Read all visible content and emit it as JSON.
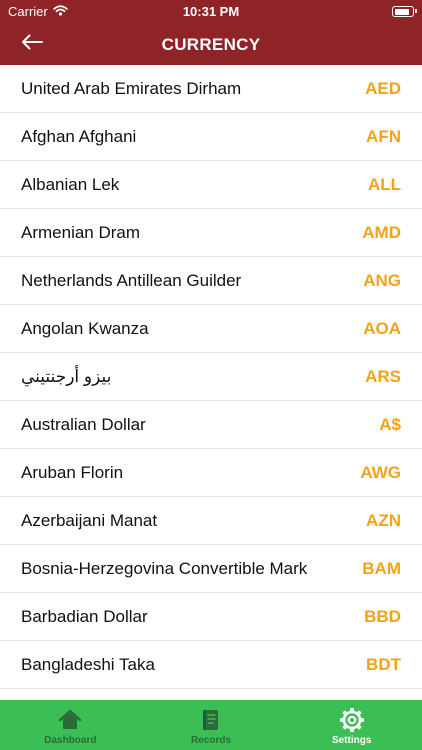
{
  "status_bar": {
    "carrier": "Carrier",
    "time": "10:31 PM",
    "wifi_icon": "wifi-icon",
    "battery_icon": "battery-icon",
    "battery_level": 0.85
  },
  "header": {
    "title": "CURRENCY",
    "back_icon": "back-arrow-icon"
  },
  "currencies": [
    {
      "name": "United Arab Emirates Dirham",
      "code": "AED"
    },
    {
      "name": "Afghan Afghani",
      "code": "AFN"
    },
    {
      "name": "Albanian Lek",
      "code": "ALL"
    },
    {
      "name": "Armenian Dram",
      "code": "AMD"
    },
    {
      "name": "Netherlands Antillean Guilder",
      "code": "ANG"
    },
    {
      "name": "Angolan Kwanza",
      "code": "AOA"
    },
    {
      "name": "بيزو أرجنتيني",
      "code": "ARS"
    },
    {
      "name": "Australian Dollar",
      "code": "A$"
    },
    {
      "name": "Aruban Florin",
      "code": "AWG"
    },
    {
      "name": "Azerbaijani Manat",
      "code": "AZN"
    },
    {
      "name": "Bosnia-Herzegovina Convertible Mark",
      "code": "BAM"
    },
    {
      "name": "Barbadian Dollar",
      "code": "BBD"
    },
    {
      "name": "Bangladeshi Taka",
      "code": "BDT"
    },
    {
      "name": "",
      "code": ""
    }
  ],
  "tab_bar": {
    "tabs": [
      {
        "label": "Dashboard",
        "icon": "home-icon",
        "active": false
      },
      {
        "label": "Records",
        "icon": "book-icon",
        "active": false
      },
      {
        "label": "Settings",
        "icon": "gear-icon",
        "active": true
      }
    ]
  },
  "colors": {
    "header_background": "#8e2427",
    "currency_code": "#f5a21b",
    "tab_bar_background": "#3bbf55",
    "tab_inactive": "#2b6b37",
    "tab_active": "#ffffff"
  }
}
